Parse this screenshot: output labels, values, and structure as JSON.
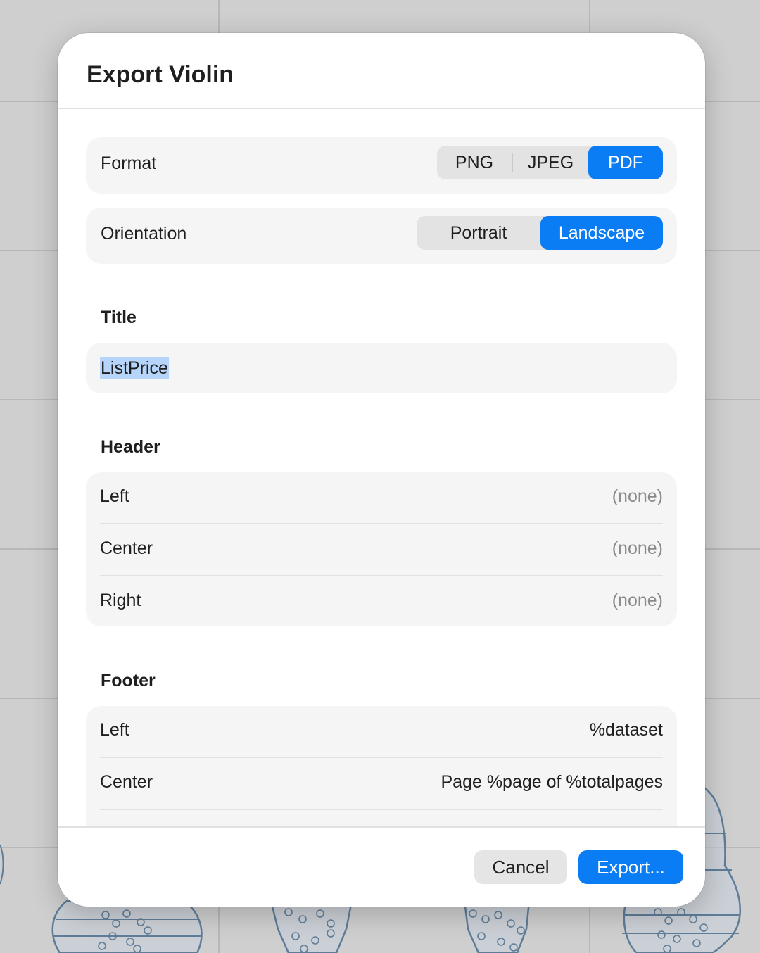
{
  "dialog": {
    "title": "Export Violin",
    "format": {
      "label": "Format",
      "options": [
        "PNG",
        "JPEG",
        "PDF"
      ],
      "selected": "PDF"
    },
    "orientation": {
      "label": "Orientation",
      "options": [
        "Portrait",
        "Landscape"
      ],
      "selected": "Landscape"
    },
    "title_field": {
      "label": "Title",
      "value": "ListPrice"
    },
    "header": {
      "label": "Header",
      "rows": [
        {
          "label": "Left",
          "value": "(none)"
        },
        {
          "label": "Center",
          "value": "(none)"
        },
        {
          "label": "Right",
          "value": "(none)"
        }
      ]
    },
    "footer": {
      "label": "Footer",
      "rows": [
        {
          "label": "Left",
          "value": "%dataset"
        },
        {
          "label": "Center",
          "value": "Page %page of %totalpages"
        }
      ]
    },
    "buttons": {
      "cancel": "Cancel",
      "export": "Export..."
    }
  },
  "colors": {
    "accent": "#0a7cf4",
    "selection": "#b7d5fb",
    "violin_stroke": "#5f7d99",
    "violin_fill": "#c8d2dc"
  }
}
